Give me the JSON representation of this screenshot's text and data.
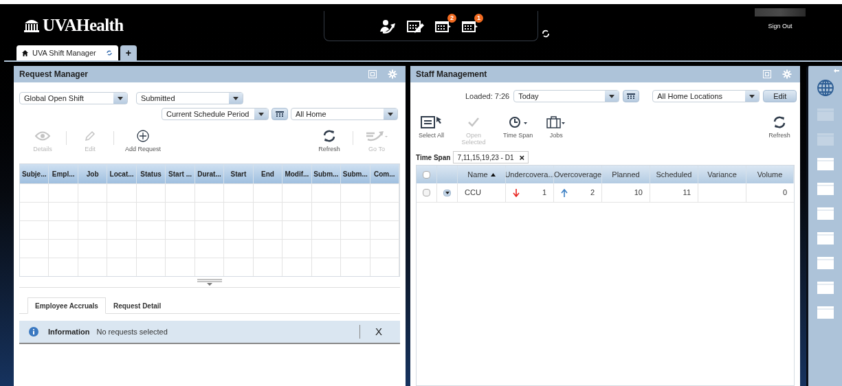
{
  "header": {
    "logo": "UVAHealth",
    "toolbar": [
      {
        "kind": "person"
      },
      {
        "kind": "calendar-edit"
      },
      {
        "kind": "calendar",
        "badge": "2"
      },
      {
        "kind": "calendar",
        "badge": "1"
      }
    ],
    "sign_out": "Sign Out"
  },
  "app_tabs": [
    {
      "label": "UVA Shift Manager",
      "selected": true
    },
    {
      "label": "+",
      "selected": false
    }
  ],
  "request_manager": {
    "title": "Request Manager",
    "filters": [
      {
        "value": "Global Open Shift"
      },
      {
        "value": "Submitted"
      },
      {
        "value": "Current Schedule Period"
      },
      {
        "value": "All Home"
      }
    ],
    "toolbar": [
      {
        "kind": "eye",
        "label": "Details",
        "disabled": true
      },
      {
        "kind": "pencil",
        "label": "Edit",
        "disabled": true
      },
      {
        "kind": "plus",
        "label": "Add Request",
        "disabled": false
      },
      {
        "kind": "refresh",
        "label": "Refresh",
        "disabled": false
      },
      {
        "kind": "goto",
        "label": "Go To",
        "disabled": true
      }
    ],
    "table": {
      "columns": [
        "Subje...",
        "Empl...",
        "Job",
        "Locat...",
        "Status",
        "Start ...",
        "Durat...",
        "Start",
        "End",
        "Modif...",
        "Subm...",
        "Subm...",
        "Com..."
      ]
    },
    "tabs": [
      {
        "label": "Employee Accruals",
        "selected": true
      },
      {
        "label": "Request Detail",
        "selected": false
      }
    ],
    "info": {
      "title": "Information",
      "message": "No requests selected",
      "close": "X"
    }
  },
  "staff_management": {
    "title": "Staff Management",
    "loaded": "Loaded: 7:26",
    "period": "Today",
    "locations": "All Home Locations",
    "edit": "Edit",
    "toolbar": [
      {
        "kind": "select",
        "label": "Select All",
        "disabled": false
      },
      {
        "kind": "check",
        "label": "Open Selected",
        "disabled": true
      },
      {
        "kind": "clock",
        "label": "Time Span",
        "disabled": false
      },
      {
        "kind": "briefcase",
        "label": "Jobs",
        "disabled": false
      },
      {
        "kind": "refresh",
        "label": "Refresh",
        "disabled": false
      }
    ],
    "time_span": {
      "label": "Time Span",
      "value": "7,11,15,19,23 - D1",
      "remove": "×"
    },
    "table": {
      "select_all_checked": false,
      "columns": [
        {
          "label": "Name",
          "sorted": true
        },
        {
          "label": "Undercovera..."
        },
        {
          "label": "Overcoverage"
        },
        {
          "label": "Planned"
        },
        {
          "label": "Scheduled"
        },
        {
          "label": "Variance"
        },
        {
          "label": "Volume"
        }
      ],
      "rows": [
        {
          "checked": false,
          "name": "CCU",
          "undercoverage": "1",
          "overcoverage": "2",
          "planned": "10",
          "scheduled": "11",
          "volume": "0"
        }
      ]
    }
  },
  "sidebar": {
    "items": [
      {
        "kind": "globe",
        "disabled": false
      },
      {
        "kind": "window",
        "disabled": true
      },
      {
        "kind": "window",
        "disabled": true
      },
      {
        "kind": "window",
        "disabled": false
      },
      {
        "kind": "window",
        "disabled": false
      },
      {
        "kind": "window",
        "disabled": false
      },
      {
        "kind": "window",
        "disabled": false
      },
      {
        "kind": "window",
        "disabled": false
      },
      {
        "kind": "window",
        "disabled": false
      },
      {
        "kind": "window",
        "disabled": false
      }
    ]
  }
}
